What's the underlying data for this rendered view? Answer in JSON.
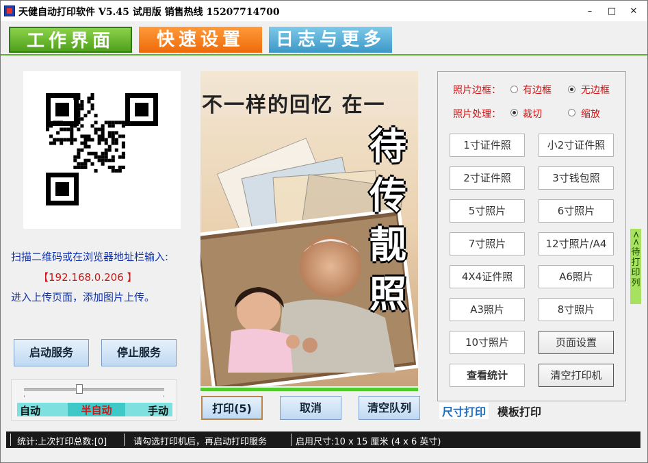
{
  "title": "天健自动打印软件  V5.45  试用版 销售热线 15207714700",
  "window_controls": {
    "minimize": "–",
    "maximize": "□",
    "close": "✕"
  },
  "tabs": {
    "work": "工作界面",
    "quick": "快速设置",
    "log": "日志与更多"
  },
  "left": {
    "scan_text": "扫描二维码或在浏览器地址栏输入:",
    "ip_text": "【192.168.0.206 】",
    "upload_text": "进入上传页面，添加图片上传。",
    "start_button": "启动服务",
    "stop_button": "停止服务",
    "mode_slider": {
      "options": [
        "自动",
        "半自动",
        "手动"
      ],
      "selected": "半自动",
      "level": 0.5
    }
  },
  "preview": {
    "top_text": "不一样的回忆 在一",
    "side_chars": [
      "待",
      "传",
      "靓",
      "照"
    ]
  },
  "buttons": {
    "print": "打印(5)",
    "cancel": "取消",
    "clear_queue": "清空队列"
  },
  "options": {
    "border_label": "照片边框：",
    "border_options": [
      {
        "label": "有边框",
        "checked": false
      },
      {
        "label": "无边框",
        "checked": true
      }
    ],
    "process_label": "照片处理：",
    "process_options": [
      {
        "label": "裁切",
        "checked": true
      },
      {
        "label": "缩放",
        "checked": false
      }
    ]
  },
  "size_buttons": [
    "1寸证件照",
    "小2寸证件照",
    "2寸证件照",
    "3寸钱包照",
    "5寸照片",
    "6寸照片",
    "7寸照片",
    "12寸照片/A4",
    "4X4证件照",
    "A6照片",
    "A3照片",
    "8寸照片",
    "10寸照片",
    "页面设置",
    "查看统计",
    "清空打印机"
  ],
  "bottom_tabs": {
    "size_print": "尺寸打印",
    "template_print": "模板打印"
  },
  "side_tab": {
    "arrows": "<<",
    "label": "待打印列"
  },
  "status": {
    "stats": "统计:上次打印总数:[0]",
    "hint": "请勾选打印机后，再启动打印服务",
    "size": "启用尺寸:10 x 15 厘米 (4 x 6 英寸)"
  },
  "colors": {
    "green_tab": "#5fb52a",
    "orange_tab": "#f57c18",
    "blue_tab": "#4fb0d8",
    "link_blue": "#1033b0",
    "alert_red": "#d21414"
  }
}
